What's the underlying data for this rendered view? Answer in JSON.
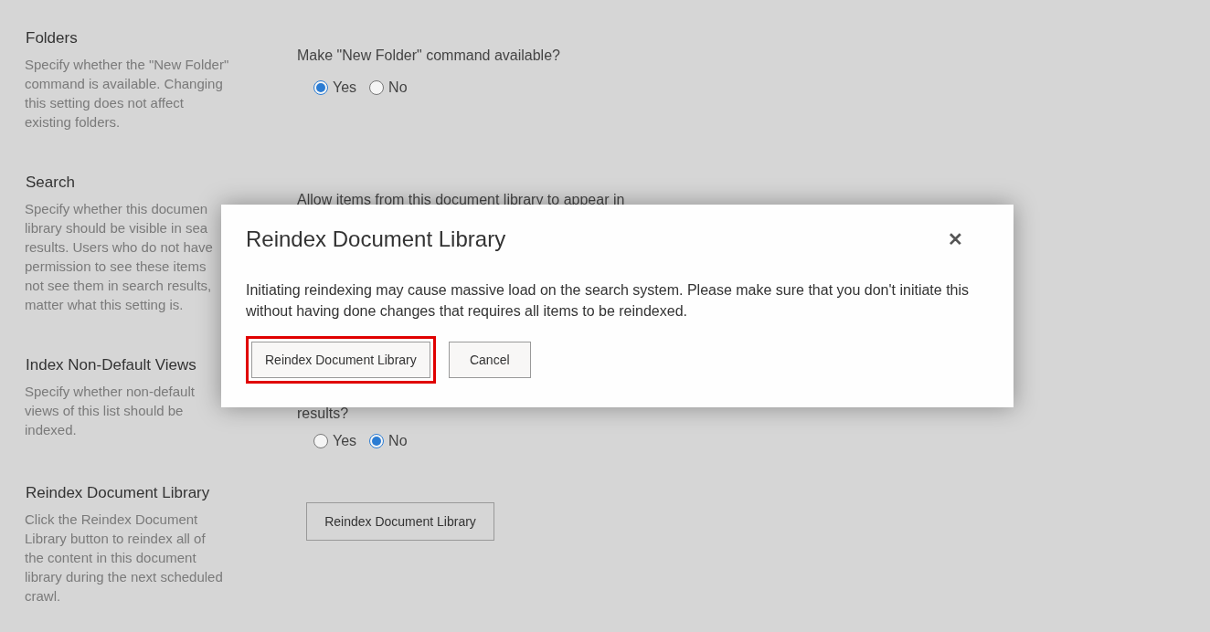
{
  "sections": [
    {
      "title": "Folders",
      "description": [
        "Specify whether the \"New Folder\"",
        "command is available. Changing",
        "this setting does not affect",
        "existing folders."
      ],
      "question": "Make \"New Folder\" command available?",
      "options": [
        {
          "label": "Yes",
          "selected": true
        },
        {
          "label": "No",
          "selected": false
        }
      ]
    },
    {
      "title": "Search",
      "description": [
        "Specify whether this documen",
        "library should be visible in sea",
        "results. Users who do not have",
        "permission to see these items",
        "not see them in search results,",
        "matter what this setting is."
      ],
      "question": "Allow items from this document library to appear in"
    },
    {
      "title": "Index Non-Default Views",
      "description": [
        "Specify whether non-default",
        "views of this list should be",
        "indexed."
      ],
      "question": "results?",
      "options": [
        {
          "label": "Yes",
          "selected": false
        },
        {
          "label": "No",
          "selected": true
        }
      ]
    },
    {
      "title": "Reindex Document Library",
      "description": [
        "Click the Reindex Document",
        "Library button to reindex all of",
        "the content in this document",
        "library during the next scheduled",
        "crawl."
      ],
      "button": "Reindex Document Library"
    }
  ],
  "dialog": {
    "title": "Reindex Document Library",
    "close": "✕",
    "message": "Initiating reindexing may cause massive load on the search system. Please make sure that you don't initiate this without having done changes that requires all items to be reindexed.",
    "buttons": [
      {
        "label": "Reindex Document Library",
        "highlighted": true
      },
      {
        "label": "Cancel",
        "highlighted": false
      }
    ]
  }
}
